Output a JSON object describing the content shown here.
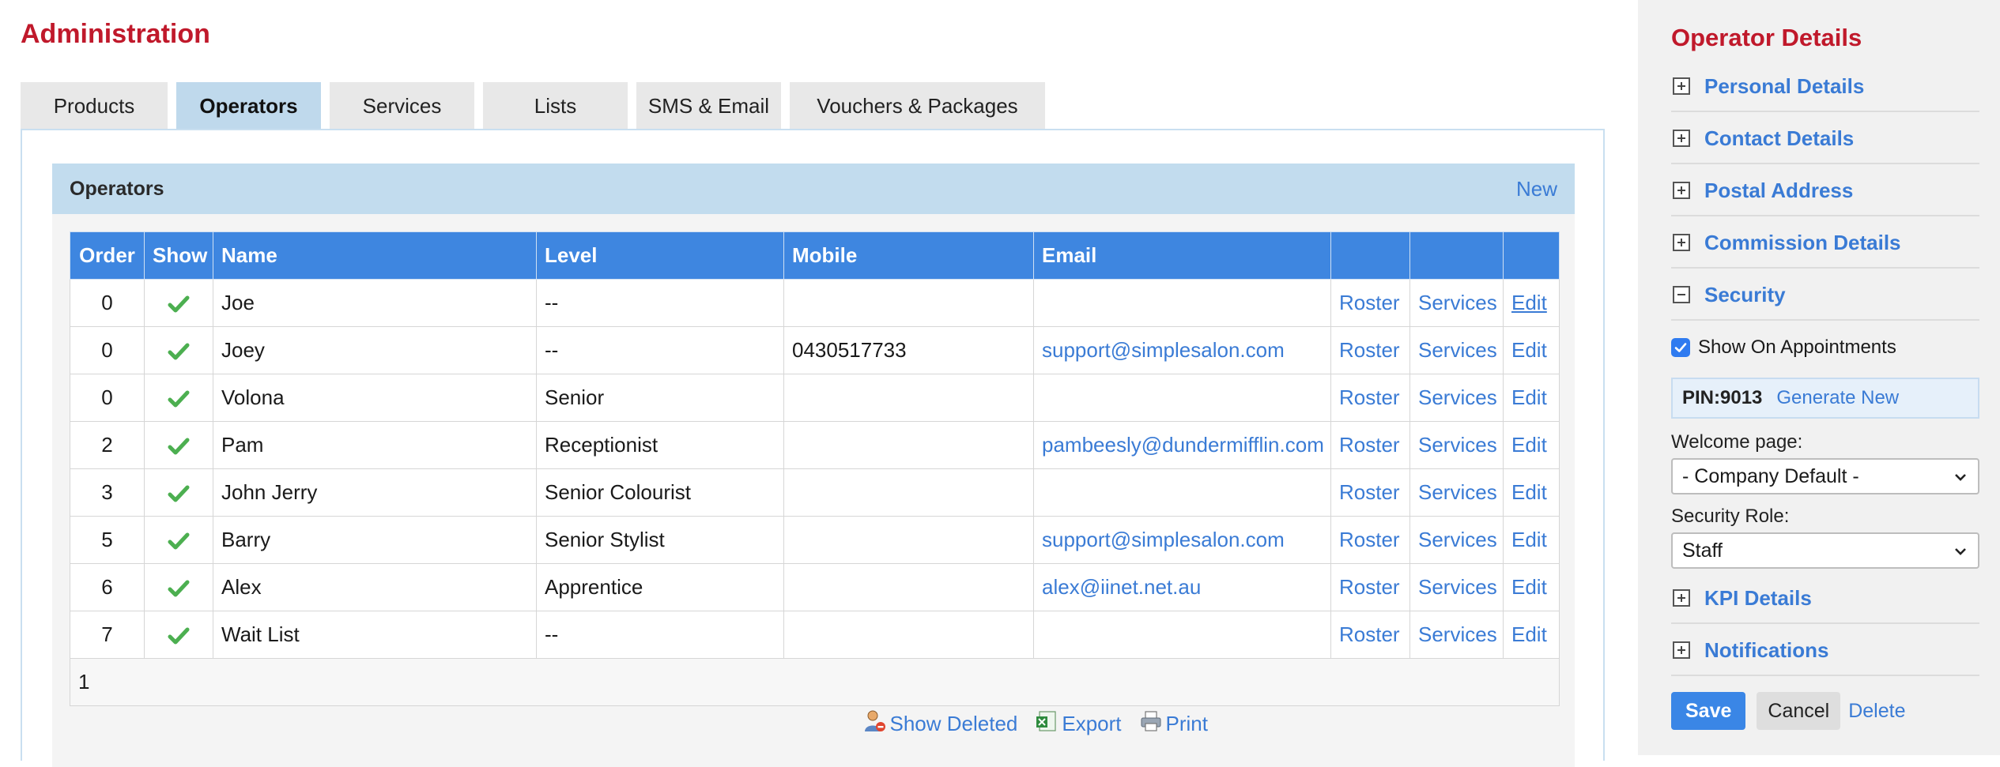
{
  "page": {
    "title": "Administration"
  },
  "tabs": [
    {
      "label": "Products"
    },
    {
      "label": "Operators",
      "active": true
    },
    {
      "label": "Services"
    },
    {
      "label": "Lists"
    },
    {
      "label": "SMS & Email"
    },
    {
      "label": "Vouchers & Packages"
    }
  ],
  "operators_panel": {
    "title": "Operators",
    "new_link": "New",
    "columns": [
      "Order",
      "Show",
      "Name",
      "Level",
      "Mobile",
      "Email",
      "",
      "",
      ""
    ],
    "rows": [
      {
        "order": "0",
        "show": true,
        "name": "Joe",
        "level": "--",
        "mobile": "",
        "email": "",
        "roster": "Roster",
        "services": "Services",
        "edit": "Edit"
      },
      {
        "order": "0",
        "show": true,
        "name": "Joey",
        "level": "--",
        "mobile": "0430517733",
        "email": "support@simplesalon.com",
        "roster": "Roster",
        "services": "Services",
        "edit": "Edit"
      },
      {
        "order": "0",
        "show": true,
        "name": "Volona",
        "level": "Senior",
        "mobile": "",
        "email": "",
        "roster": "Roster",
        "services": "Services",
        "edit": "Edit"
      },
      {
        "order": "2",
        "show": true,
        "name": "Pam",
        "level": "Receptionist",
        "mobile": "",
        "email": "pambeesly@dundermifflin.com",
        "roster": "Roster",
        "services": "Services",
        "edit": "Edit"
      },
      {
        "order": "3",
        "show": true,
        "name": "John Jerry",
        "level": "Senior Colourist",
        "mobile": "",
        "email": "",
        "roster": "Roster",
        "services": "Services",
        "edit": "Edit"
      },
      {
        "order": "5",
        "show": true,
        "name": "Barry",
        "level": "Senior Stylist",
        "mobile": "",
        "email": "support@simplesalon.com",
        "roster": "Roster",
        "services": "Services",
        "edit": "Edit"
      },
      {
        "order": "6",
        "show": true,
        "name": "Alex",
        "level": "Apprentice",
        "mobile": "",
        "email": "alex@iinet.net.au",
        "roster": "Roster",
        "services": "Services",
        "edit": "Edit"
      },
      {
        "order": "7",
        "show": true,
        "name": "Wait List",
        "level": "--",
        "mobile": "",
        "email": "",
        "roster": "Roster",
        "services": "Services",
        "edit": "Edit"
      }
    ],
    "pager": "1",
    "footer": {
      "show_deleted": "Show Deleted",
      "export": "Export",
      "print": "Print"
    }
  },
  "sidebar": {
    "title": "Operator Details",
    "sections_top": [
      {
        "label": "Personal Details",
        "expanded": false
      },
      {
        "label": "Contact Details",
        "expanded": false
      },
      {
        "label": "Postal Address",
        "expanded": false
      },
      {
        "label": "Commission Details",
        "expanded": false
      },
      {
        "label": "Security",
        "expanded": true
      }
    ],
    "show_on_appointments": {
      "label": "Show On Appointments",
      "checked": true
    },
    "pin": {
      "label": "PIN:9013",
      "generate": "Generate New"
    },
    "welcome_page": {
      "label": "Welcome page:",
      "value": "- Company Default -"
    },
    "security_role": {
      "label": "Security Role:",
      "value": "Staff"
    },
    "sections_bottom": [
      {
        "label": "KPI Details",
        "expanded": false
      },
      {
        "label": "Notifications",
        "expanded": false
      }
    ],
    "buttons": {
      "save": "Save",
      "cancel": "Cancel",
      "delete": "Delete"
    }
  },
  "colors": {
    "accent": "#3a7bd5",
    "title_red": "#c0192b",
    "table_header": "#3e86e0",
    "check_green": "#4caf50"
  }
}
